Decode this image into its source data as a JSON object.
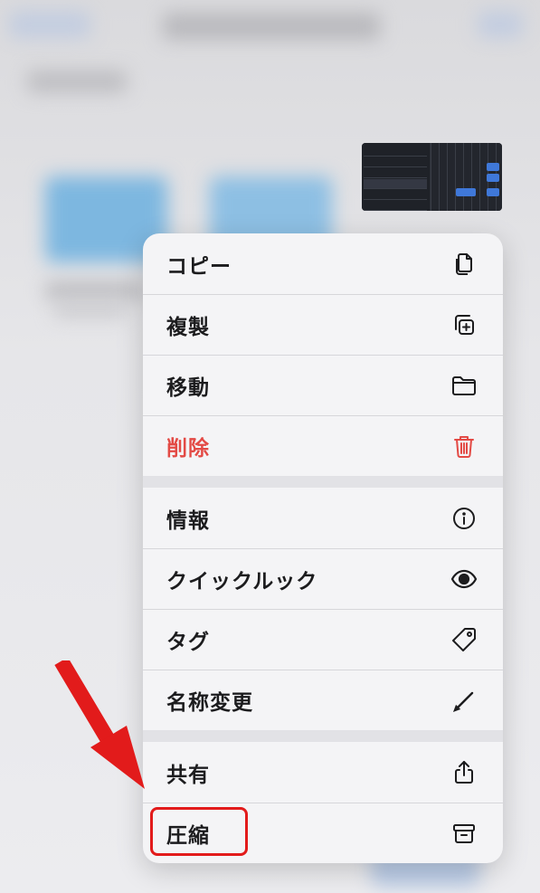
{
  "background": {
    "description_color": "#e3e3e6"
  },
  "menu": {
    "groups": [
      [
        {
          "label": "コピー",
          "icon": "copy-icon",
          "destructive": false
        },
        {
          "label": "複製",
          "icon": "duplicate-icon",
          "destructive": false
        },
        {
          "label": "移動",
          "icon": "folder-icon",
          "destructive": false
        },
        {
          "label": "削除",
          "icon": "trash-icon",
          "destructive": true
        }
      ],
      [
        {
          "label": "情報",
          "icon": "info-icon",
          "destructive": false
        },
        {
          "label": "クイックルック",
          "icon": "eye-icon",
          "destructive": false
        },
        {
          "label": "タグ",
          "icon": "tag-icon",
          "destructive": false
        },
        {
          "label": "名称変更",
          "icon": "pencil-icon",
          "destructive": false
        }
      ],
      [
        {
          "label": "共有",
          "icon": "share-icon",
          "destructive": false
        },
        {
          "label": "圧縮",
          "icon": "archive-box-icon",
          "destructive": false
        }
      ]
    ]
  },
  "colors": {
    "destructive": "#e34a45",
    "annotation": "#e21b1b"
  }
}
